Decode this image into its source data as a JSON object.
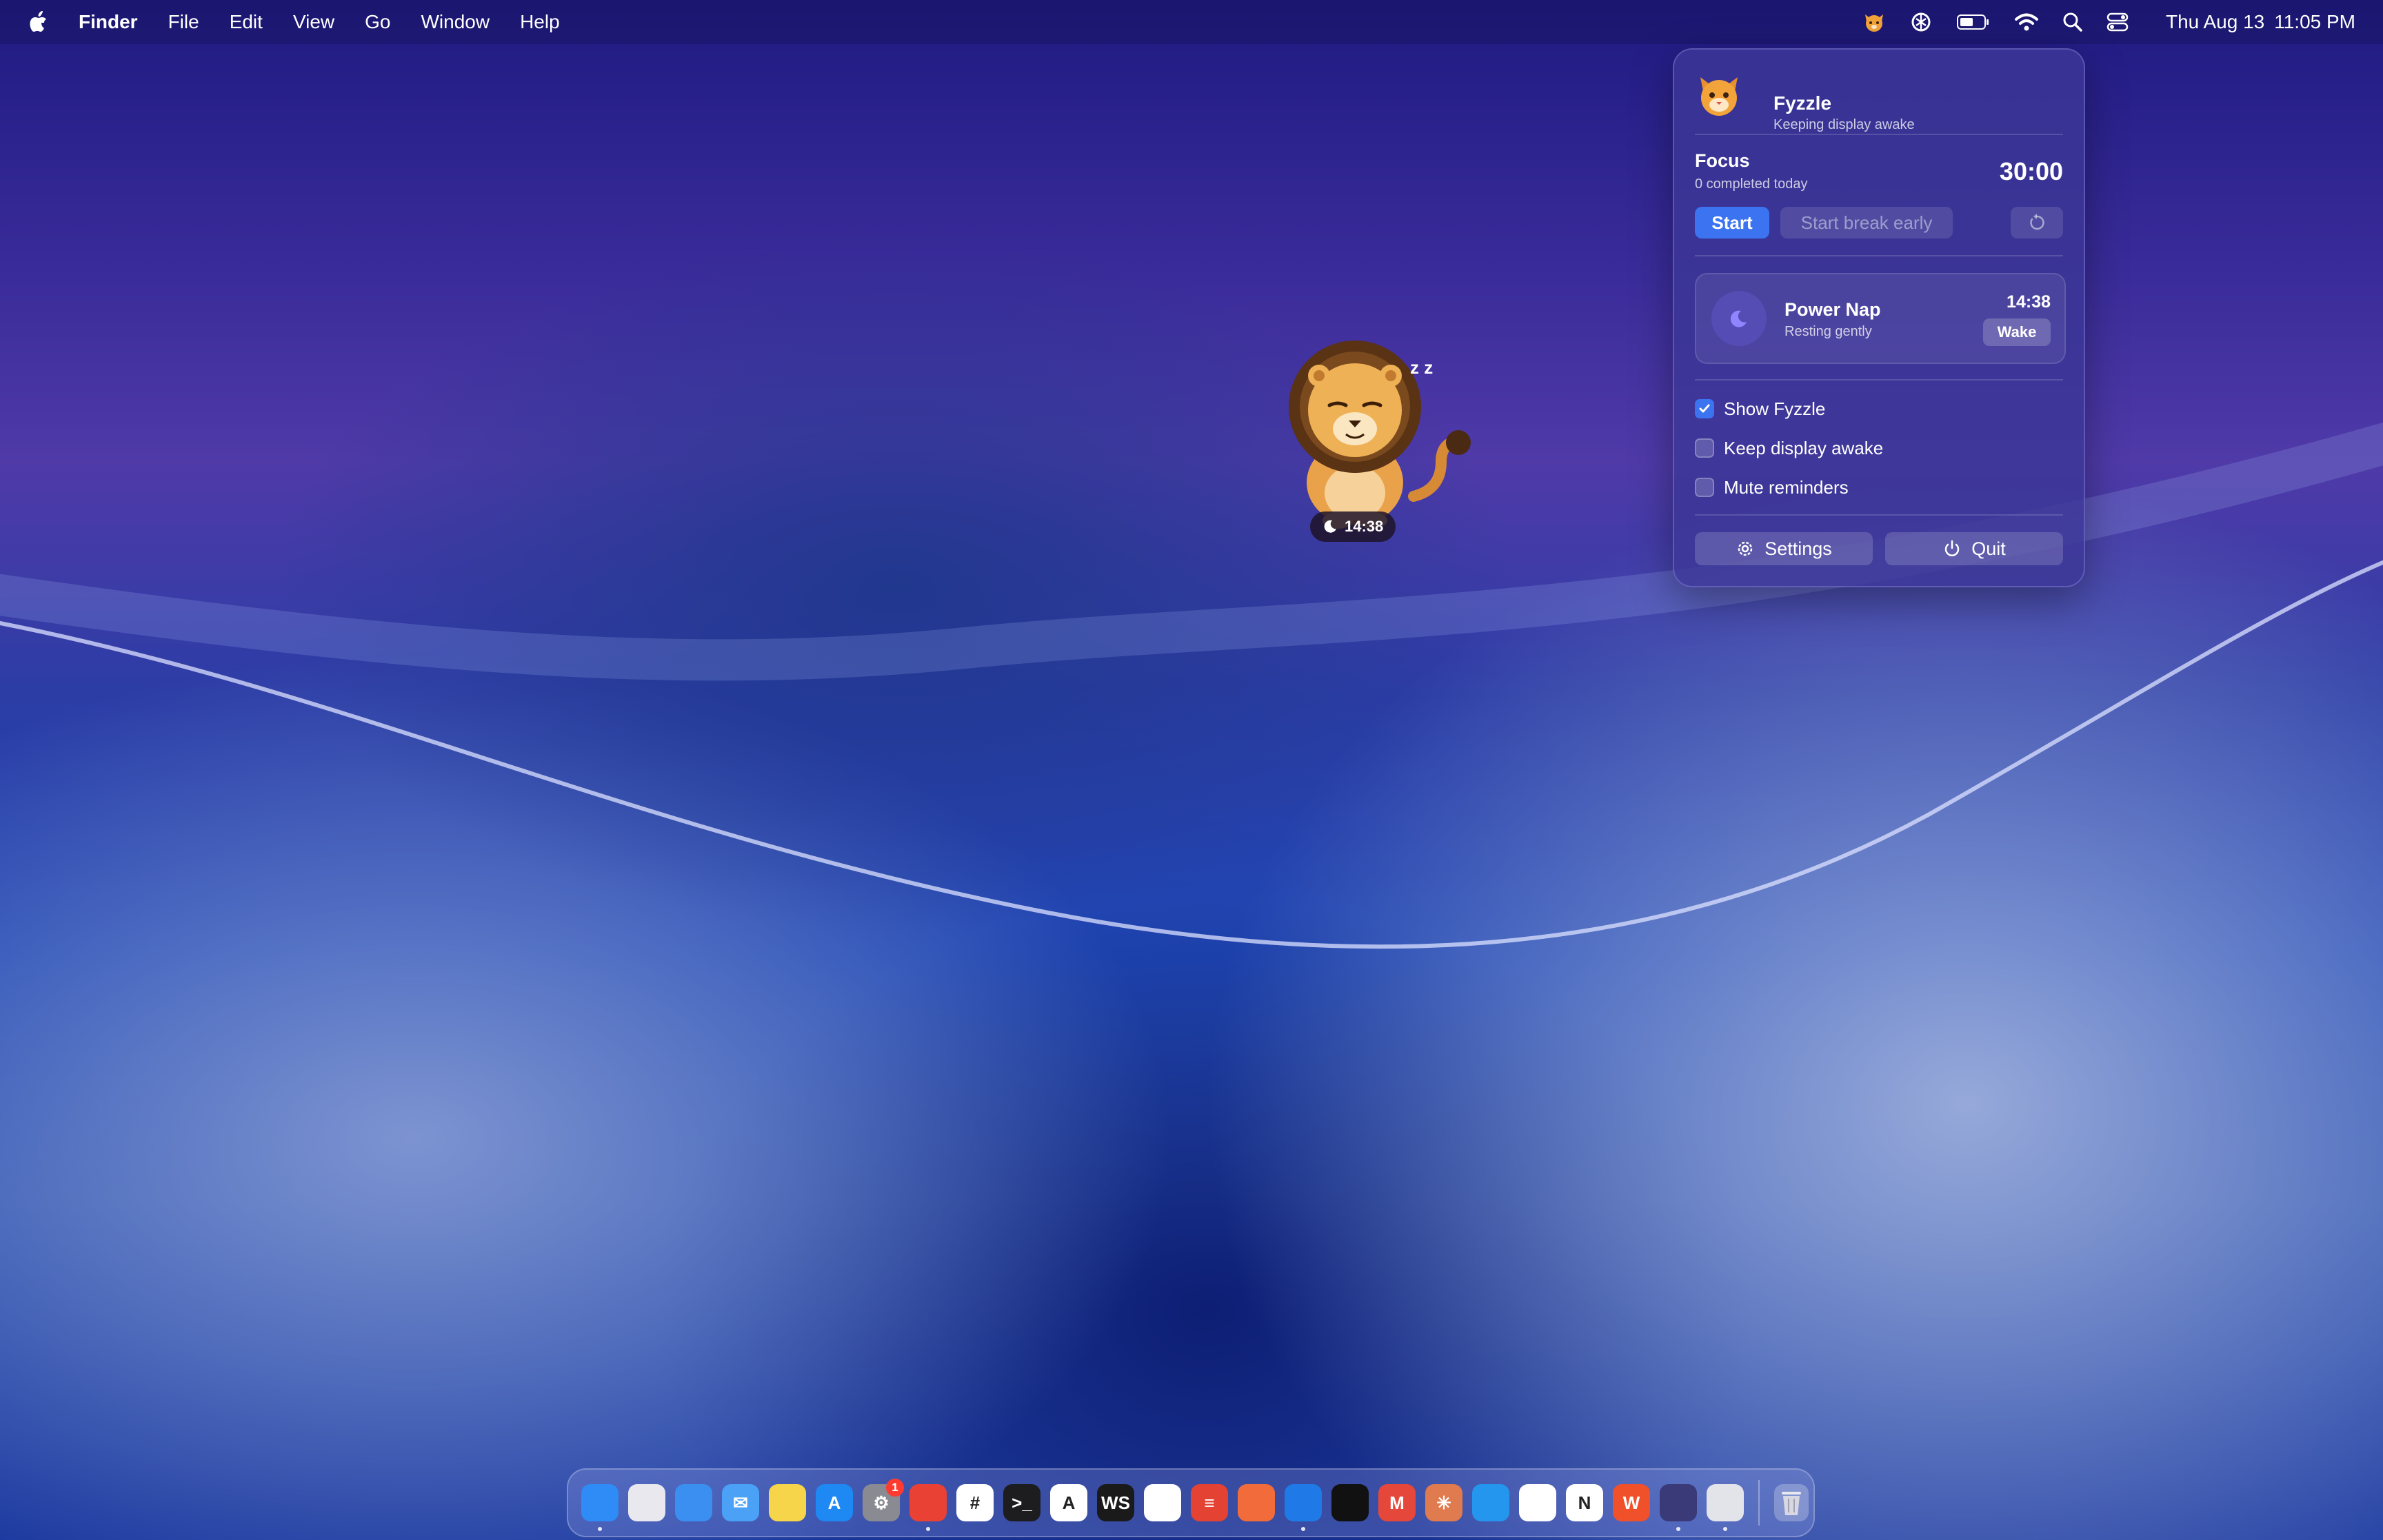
{
  "menubar": {
    "app_name": "Finder",
    "menus": [
      "File",
      "Edit",
      "View",
      "Go",
      "Window",
      "Help"
    ],
    "status_icons": [
      "fyzzle-cat-icon",
      "chatgpt-icon",
      "battery-icon",
      "wifi-icon",
      "spotlight-search-icon",
      "control-center-icon"
    ],
    "clock_date": "Thu Aug 13",
    "clock_time": "11:05 PM"
  },
  "pet": {
    "timer": "14:38",
    "sleep_mark": "z z"
  },
  "panel": {
    "app_title": "Fyzzle",
    "app_status": "Keeping display awake",
    "focus": {
      "title": "Focus",
      "completed": "0 completed today",
      "time": "30:00",
      "start_label": "Start",
      "break_label": "Start break early"
    },
    "nap": {
      "title": "Power Nap",
      "status": "Resting gently",
      "time": "14:38",
      "wake_label": "Wake"
    },
    "options": [
      {
        "label": "Show Fyzzle",
        "checked": true
      },
      {
        "label": "Keep display awake",
        "checked": false
      },
      {
        "label": "Mute reminders",
        "checked": false
      }
    ],
    "settings_label": "Settings",
    "quit_label": "Quit"
  },
  "dock": {
    "apps": [
      {
        "name": "Finder",
        "glyph": "",
        "color": "#2f8cf6",
        "running": true
      },
      {
        "name": "Launchpad",
        "glyph": "",
        "color": "#e8e8ee",
        "running": false
      },
      {
        "name": "Safari",
        "glyph": "",
        "color": "#3a8ff0",
        "running": false
      },
      {
        "name": "Mail",
        "glyph": "✉",
        "color": "#4aa1f5",
        "running": false
      },
      {
        "name": "Notes",
        "glyph": "",
        "color": "#f6d54a",
        "running": false
      },
      {
        "name": "App Store",
        "glyph": "A",
        "color": "#1e88f3",
        "running": false
      },
      {
        "name": "System Settings",
        "glyph": "⚙",
        "color": "#8a8a92",
        "running": false,
        "badge": "1"
      },
      {
        "name": "Chrome",
        "glyph": "",
        "color": "#e94235",
        "running": true
      },
      {
        "name": "Slack",
        "glyph": "#",
        "color": "#ffffff",
        "running": false
      },
      {
        "name": "Terminal",
        "glyph": ">_",
        "color": "#1d1d1f",
        "running": false
      },
      {
        "name": "Instruments",
        "glyph": "A",
        "color": "#ffffff",
        "running": false
      },
      {
        "name": "WebStorm",
        "glyph": "WS",
        "color": "#1a1a1a",
        "running": false
      },
      {
        "name": "pgAdmin",
        "glyph": "",
        "color": "#ffffff",
        "running": false
      },
      {
        "name": "Todoist",
        "glyph": "≡",
        "color": "#e44232",
        "running": false
      },
      {
        "name": "Postman",
        "glyph": "",
        "color": "#f26b3a",
        "running": false
      },
      {
        "name": "Xcode",
        "glyph": "",
        "color": "#1f7ae8",
        "running": true
      },
      {
        "name": "Cursor",
        "glyph": "",
        "color": "#111111",
        "running": false
      },
      {
        "name": "Mindmap",
        "glyph": "M",
        "color": "#e5483a",
        "running": false
      },
      {
        "name": "Claude",
        "glyph": "✳",
        "color": "#e07a4f",
        "running": false
      },
      {
        "name": "Docker",
        "glyph": "",
        "color": "#2496ed",
        "running": false
      },
      {
        "name": "VS Code",
        "glyph": "",
        "color": "#ffffff",
        "running": false
      },
      {
        "name": "Notion",
        "glyph": "N",
        "color": "#ffffff",
        "running": false
      },
      {
        "name": "WPS Office",
        "glyph": "W",
        "color": "#f0502a",
        "running": false
      },
      {
        "name": "Screen Saver",
        "glyph": "",
        "color": "#3a3a78",
        "running": true
      },
      {
        "name": "Preview",
        "glyph": "",
        "color": "#e3e3ea",
        "running": true
      }
    ],
    "trash": {
      "name": "Trash"
    }
  }
}
